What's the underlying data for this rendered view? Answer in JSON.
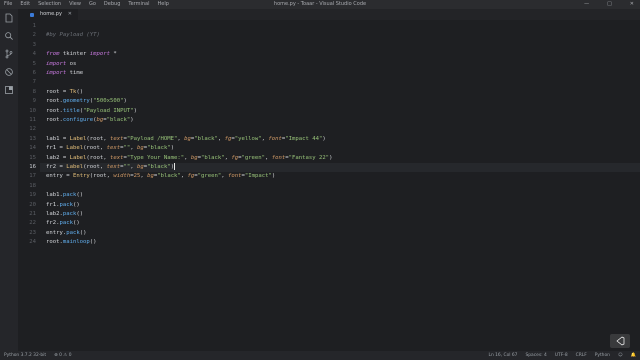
{
  "window": {
    "title": "home.py - Toaar - Visual Studio Code",
    "menu": [
      "File",
      "Edit",
      "Selection",
      "View",
      "Go",
      "Debug",
      "Terminal",
      "Help"
    ],
    "controls": [
      "—",
      "□",
      "✕"
    ]
  },
  "tab": {
    "label": "home.py",
    "close": "✕"
  },
  "activity_icons": [
    "files-icon",
    "search-icon",
    "source-control-icon",
    "debug-icon",
    "extensions-icon"
  ],
  "editor": {
    "current_line": 16,
    "lines": [
      {
        "n": 1,
        "tokens": []
      },
      {
        "n": 2,
        "tokens": [
          {
            "t": "#by Payload (YT)",
            "c": "c-comment"
          }
        ]
      },
      {
        "n": 3,
        "tokens": []
      },
      {
        "n": 4,
        "tokens": [
          {
            "t": "from",
            "c": "c-kw"
          },
          {
            "t": " tkinter ",
            "c": "c-plain"
          },
          {
            "t": "import",
            "c": "c-kw"
          },
          {
            "t": " *",
            "c": "c-plain"
          }
        ]
      },
      {
        "n": 5,
        "tokens": [
          {
            "t": "import",
            "c": "c-kw"
          },
          {
            "t": " os",
            "c": "c-plain"
          }
        ]
      },
      {
        "n": 6,
        "tokens": [
          {
            "t": "import",
            "c": "c-kw"
          },
          {
            "t": " time",
            "c": "c-plain"
          }
        ]
      },
      {
        "n": 7,
        "tokens": []
      },
      {
        "n": 8,
        "tokens": [
          {
            "t": "root",
            "c": "c-plain"
          },
          {
            "t": " = ",
            "c": "c-plain"
          },
          {
            "t": "Tk",
            "c": "c-id"
          },
          {
            "t": "()",
            "c": "c-plain"
          }
        ]
      },
      {
        "n": 9,
        "tokens": [
          {
            "t": "root.",
            "c": "c-plain"
          },
          {
            "t": "geometry",
            "c": "c-fn"
          },
          {
            "t": "(",
            "c": "c-plain"
          },
          {
            "t": "\"500x500\"",
            "c": "c-str"
          },
          {
            "t": ")",
            "c": "c-plain"
          }
        ]
      },
      {
        "n": 10,
        "tokens": [
          {
            "t": "root.",
            "c": "c-plain"
          },
          {
            "t": "title",
            "c": "c-fn"
          },
          {
            "t": "(",
            "c": "c-plain"
          },
          {
            "t": "\"Payload INPUT\"",
            "c": "c-str"
          },
          {
            "t": ")",
            "c": "c-plain"
          }
        ]
      },
      {
        "n": 11,
        "tokens": [
          {
            "t": "root.",
            "c": "c-plain"
          },
          {
            "t": "configure",
            "c": "c-fn"
          },
          {
            "t": "(",
            "c": "c-plain"
          },
          {
            "t": "bg",
            "c": "c-param"
          },
          {
            "t": "=",
            "c": "c-plain"
          },
          {
            "t": "\"black\"",
            "c": "c-str"
          },
          {
            "t": ")",
            "c": "c-plain"
          }
        ]
      },
      {
        "n": 12,
        "tokens": []
      },
      {
        "n": 13,
        "tokens": [
          {
            "t": "lab1 = ",
            "c": "c-plain"
          },
          {
            "t": "Label",
            "c": "c-id"
          },
          {
            "t": "(root, ",
            "c": "c-plain"
          },
          {
            "t": "text",
            "c": "c-param"
          },
          {
            "t": "=",
            "c": "c-plain"
          },
          {
            "t": "\"Payload /HOME\"",
            "c": "c-str"
          },
          {
            "t": ", ",
            "c": "c-plain"
          },
          {
            "t": "bg",
            "c": "c-param"
          },
          {
            "t": "=",
            "c": "c-plain"
          },
          {
            "t": "\"black\"",
            "c": "c-str"
          },
          {
            "t": ", ",
            "c": "c-plain"
          },
          {
            "t": "fg",
            "c": "c-param"
          },
          {
            "t": "=",
            "c": "c-plain"
          },
          {
            "t": "\"yellow\"",
            "c": "c-str"
          },
          {
            "t": ", ",
            "c": "c-plain"
          },
          {
            "t": "font",
            "c": "c-param"
          },
          {
            "t": "=",
            "c": "c-plain"
          },
          {
            "t": "\"Impact 44\"",
            "c": "c-str"
          },
          {
            "t": ")",
            "c": "c-plain"
          }
        ]
      },
      {
        "n": 14,
        "tokens": [
          {
            "t": "fr1 = ",
            "c": "c-plain"
          },
          {
            "t": "Label",
            "c": "c-id"
          },
          {
            "t": "(root, ",
            "c": "c-plain"
          },
          {
            "t": "text",
            "c": "c-param"
          },
          {
            "t": "=",
            "c": "c-plain"
          },
          {
            "t": "\"\"",
            "c": "c-str"
          },
          {
            "t": ", ",
            "c": "c-plain"
          },
          {
            "t": "bg",
            "c": "c-param"
          },
          {
            "t": "=",
            "c": "c-plain"
          },
          {
            "t": "\"black\"",
            "c": "c-str"
          },
          {
            "t": ")",
            "c": "c-plain"
          }
        ]
      },
      {
        "n": 15,
        "tokens": [
          {
            "t": "lab2 = ",
            "c": "c-plain"
          },
          {
            "t": "Label",
            "c": "c-id"
          },
          {
            "t": "(root, ",
            "c": "c-plain"
          },
          {
            "t": "text",
            "c": "c-param"
          },
          {
            "t": "=",
            "c": "c-plain"
          },
          {
            "t": "\"Type Your Name:\"",
            "c": "c-str"
          },
          {
            "t": ", ",
            "c": "c-plain"
          },
          {
            "t": "bg",
            "c": "c-param"
          },
          {
            "t": "=",
            "c": "c-plain"
          },
          {
            "t": "\"black\"",
            "c": "c-str"
          },
          {
            "t": ", ",
            "c": "c-plain"
          },
          {
            "t": "fg",
            "c": "c-param"
          },
          {
            "t": "=",
            "c": "c-plain"
          },
          {
            "t": "\"green\"",
            "c": "c-str"
          },
          {
            "t": ", ",
            "c": "c-plain"
          },
          {
            "t": "font",
            "c": "c-param"
          },
          {
            "t": "=",
            "c": "c-plain"
          },
          {
            "t": "\"Fantasy 22\"",
            "c": "c-str"
          },
          {
            "t": ")",
            "c": "c-plain"
          }
        ]
      },
      {
        "n": 16,
        "tokens": [
          {
            "t": "fr2 = ",
            "c": "c-plain"
          },
          {
            "t": "Label",
            "c": "c-id"
          },
          {
            "t": "(root, ",
            "c": "c-plain"
          },
          {
            "t": "text",
            "c": "c-param"
          },
          {
            "t": "=",
            "c": "c-plain"
          },
          {
            "t": "\"\"",
            "c": "c-str"
          },
          {
            "t": ", ",
            "c": "c-plain"
          },
          {
            "t": "bg",
            "c": "c-param"
          },
          {
            "t": "=",
            "c": "c-plain"
          },
          {
            "t": "\"black\"",
            "c": "c-str"
          },
          {
            "t": ")",
            "c": "c-plain"
          }
        ]
      },
      {
        "n": 17,
        "tokens": [
          {
            "t": "entry = ",
            "c": "c-plain"
          },
          {
            "t": "Entry",
            "c": "c-id"
          },
          {
            "t": "(root, ",
            "c": "c-plain"
          },
          {
            "t": "width",
            "c": "c-param"
          },
          {
            "t": "=",
            "c": "c-plain"
          },
          {
            "t": "25",
            "c": "c-num"
          },
          {
            "t": ", ",
            "c": "c-plain"
          },
          {
            "t": "bg",
            "c": "c-param"
          },
          {
            "t": "=",
            "c": "c-plain"
          },
          {
            "t": "\"black\"",
            "c": "c-str"
          },
          {
            "t": ", ",
            "c": "c-plain"
          },
          {
            "t": "fg",
            "c": "c-param"
          },
          {
            "t": "=",
            "c": "c-plain"
          },
          {
            "t": "\"green\"",
            "c": "c-str"
          },
          {
            "t": ", ",
            "c": "c-plain"
          },
          {
            "t": "font",
            "c": "c-param"
          },
          {
            "t": "=",
            "c": "c-plain"
          },
          {
            "t": "\"Impact\"",
            "c": "c-str"
          },
          {
            "t": ")",
            "c": "c-plain"
          }
        ]
      },
      {
        "n": 18,
        "tokens": []
      },
      {
        "n": 19,
        "tokens": [
          {
            "t": "lab1.",
            "c": "c-plain"
          },
          {
            "t": "pack",
            "c": "c-fn"
          },
          {
            "t": "()",
            "c": "c-plain"
          }
        ]
      },
      {
        "n": 20,
        "tokens": [
          {
            "t": "fr1.",
            "c": "c-plain"
          },
          {
            "t": "pack",
            "c": "c-fn"
          },
          {
            "t": "()",
            "c": "c-plain"
          }
        ]
      },
      {
        "n": 21,
        "tokens": [
          {
            "t": "lab2.",
            "c": "c-plain"
          },
          {
            "t": "pack",
            "c": "c-fn"
          },
          {
            "t": "()",
            "c": "c-plain"
          }
        ]
      },
      {
        "n": 22,
        "tokens": [
          {
            "t": "fr2.",
            "c": "c-plain"
          },
          {
            "t": "pack",
            "c": "c-fn"
          },
          {
            "t": "()",
            "c": "c-plain"
          }
        ]
      },
      {
        "n": 23,
        "tokens": [
          {
            "t": "entry.",
            "c": "c-plain"
          },
          {
            "t": "pack",
            "c": "c-fn"
          },
          {
            "t": "()",
            "c": "c-plain"
          }
        ]
      },
      {
        "n": 24,
        "tokens": [
          {
            "t": "root.",
            "c": "c-plain"
          },
          {
            "t": "mainloop",
            "c": "c-fn"
          },
          {
            "t": "()",
            "c": "c-plain"
          }
        ]
      }
    ]
  },
  "statusbar": {
    "left": [
      "Python 3.7.2 32-bit",
      "⊗ 0 ⚠ 0"
    ],
    "right": [
      "Ln 16, Col 67",
      "Spaces: 4",
      "UTF-8",
      "CRLF",
      "Python",
      "☺",
      "🔔"
    ]
  },
  "colors": {
    "background": "#1e1f22",
    "accent": "#3b7bd8"
  }
}
